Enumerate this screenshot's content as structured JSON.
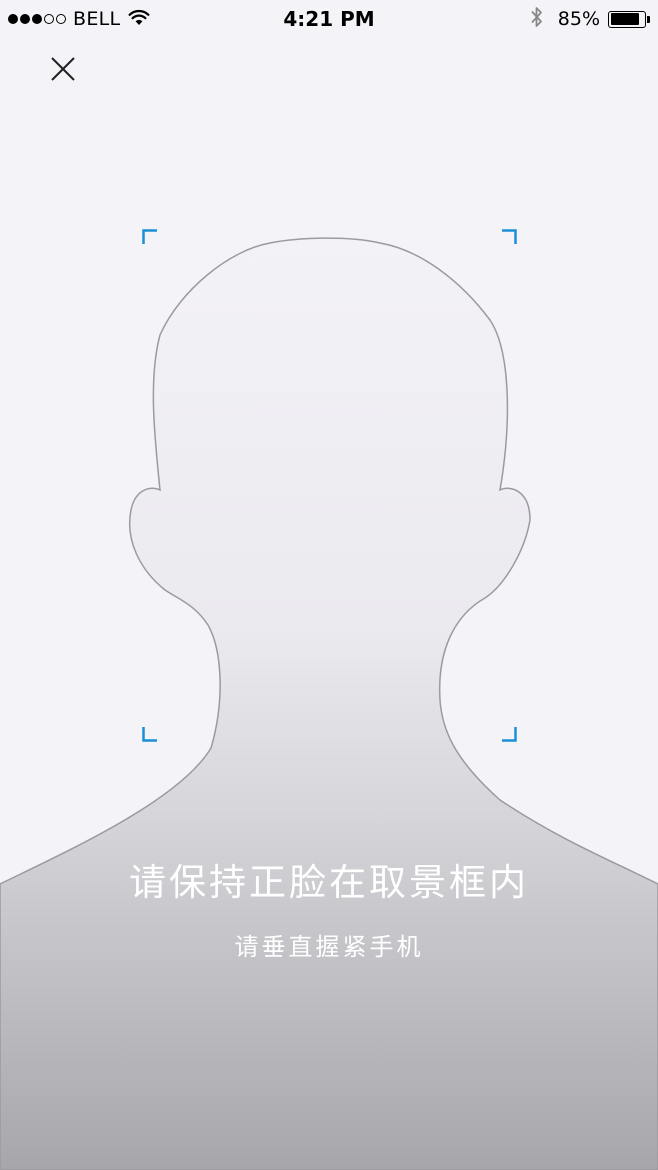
{
  "status_bar": {
    "carrier": "BELL",
    "time": "4:21 PM",
    "battery_percent": "85%",
    "battery_level": 0.85,
    "signal_bars_filled": 3,
    "signal_bars_total": 5
  },
  "icons": {
    "close": "close-icon",
    "wifi": "wifi-icon",
    "bluetooth": "bluetooth-icon",
    "battery": "battery-icon"
  },
  "colors": {
    "frame_corner": "#1a8fd6",
    "background": "#f4f3f8",
    "silhouette_outline": "#9a9a9f"
  },
  "prompt": {
    "title": "请保持正脸在取景框内",
    "subtitle": "请垂直握紧手机"
  }
}
